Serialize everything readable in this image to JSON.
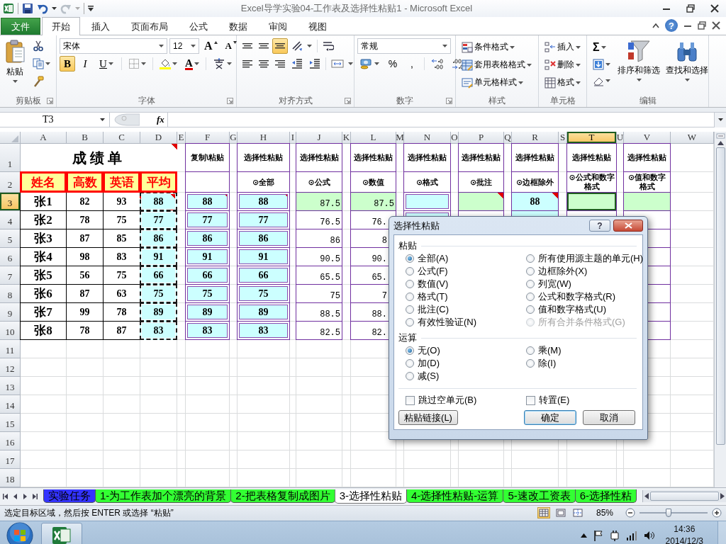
{
  "window": {
    "title": "Excel导学实验04-工作表及选择性粘贴1 - Microsoft Excel"
  },
  "ribbon": {
    "file_tab": "文件",
    "help": "?",
    "tabs": [
      {
        "label": "开始",
        "selected": true
      },
      {
        "label": "插入",
        "selected": false
      },
      {
        "label": "页面布局",
        "selected": false
      },
      {
        "label": "公式",
        "selected": false
      },
      {
        "label": "数据",
        "selected": false
      },
      {
        "label": "审阅",
        "selected": false
      },
      {
        "label": "视图",
        "selected": false
      }
    ],
    "groups": [
      {
        "kind": "clipboard",
        "label": "剪贴板",
        "paste": "粘贴"
      },
      {
        "kind": "font",
        "label": "字体",
        "font_name": "宋体",
        "font_size": "12",
        "grow": "A",
        "shrink": "A",
        "font_color": "A",
        "styles": [
          {
            "label": "B",
            "selected": true
          },
          {
            "label": "I",
            "selected": false
          },
          {
            "label": "U",
            "selected": false
          }
        ]
      },
      {
        "kind": "alignment",
        "label": "对齐方式",
        "vertical": [
          {
            "selected": false
          },
          {
            "selected": false
          },
          {
            "selected": true
          }
        ]
      },
      {
        "kind": "number",
        "label": "数字",
        "format": "常规",
        "symbols": [
          "%",
          ","
        ]
      },
      {
        "kind": "styles",
        "label": "样式",
        "items": [
          "条件格式",
          "套用表格格式",
          "单元格样式"
        ]
      },
      {
        "kind": "cells",
        "label": "单元格",
        "items": [
          "插入",
          "删除",
          "格式"
        ]
      },
      {
        "kind": "editing",
        "label": "编辑",
        "sum": "Σ",
        "items": [
          "排序和筛选",
          "查找和选择"
        ]
      }
    ]
  },
  "formula_bar": {
    "name_box": "T3",
    "fx": "fx"
  },
  "sheet": {
    "columns": [
      {
        "label": "A",
        "selected": false
      },
      {
        "label": "B",
        "selected": false
      },
      {
        "label": "C",
        "selected": false
      },
      {
        "label": "D",
        "selected": false
      },
      {
        "label": "E",
        "selected": false
      },
      {
        "label": "F",
        "selected": false
      },
      {
        "label": "G",
        "selected": false
      },
      {
        "label": "H",
        "selected": false
      },
      {
        "label": "I",
        "selected": false
      },
      {
        "label": "J",
        "selected": false
      },
      {
        "label": "K",
        "selected": false
      },
      {
        "label": "L",
        "selected": false
      },
      {
        "label": "M",
        "selected": false
      },
      {
        "label": "N",
        "selected": false
      },
      {
        "label": "O",
        "selected": false
      },
      {
        "label": "P",
        "selected": false
      },
      {
        "label": "Q",
        "selected": false
      },
      {
        "label": "R",
        "selected": false
      },
      {
        "label": "S",
        "selected": false
      },
      {
        "label": "T",
        "selected": true
      },
      {
        "label": "U",
        "selected": false
      },
      {
        "label": "V",
        "selected": false
      },
      {
        "label": "W",
        "selected": false
      }
    ],
    "rows": [
      {
        "label": "1",
        "selected": false
      },
      {
        "label": "2",
        "selected": false
      },
      {
        "label": "3",
        "selected": true
      },
      {
        "label": "4",
        "selected": false
      },
      {
        "label": "5",
        "selected": false
      },
      {
        "label": "6",
        "selected": false
      },
      {
        "label": "7",
        "selected": false
      },
      {
        "label": "8",
        "selected": false
      },
      {
        "label": "9",
        "selected": false
      },
      {
        "label": "10",
        "selected": false
      },
      {
        "label": "11",
        "selected": false
      },
      {
        "label": "12",
        "selected": false
      },
      {
        "label": "13",
        "selected": false
      },
      {
        "label": "14",
        "selected": false
      },
      {
        "label": "15",
        "selected": false
      },
      {
        "label": "16",
        "selected": false
      },
      {
        "label": "17",
        "selected": false
      },
      {
        "label": "18",
        "selected": false
      }
    ],
    "score_table": {
      "title": {
        "text": "成绩单",
        "comment": true
      },
      "headers": [
        "姓名",
        "高数",
        "英语",
        "平均"
      ],
      "rows": [
        {
          "cells": [
            {
              "text": "张1"
            },
            {
              "text": "82"
            },
            {
              "text": "93"
            },
            {
              "text": "88",
              "color": "#ccffff",
              "marquee": true,
              "comment": true
            }
          ]
        },
        {
          "cells": [
            {
              "text": "张2"
            },
            {
              "text": "78"
            },
            {
              "text": "75"
            },
            {
              "text": "77",
              "color": "#ccffff",
              "marquee": true
            }
          ]
        },
        {
          "cells": [
            {
              "text": "张3"
            },
            {
              "text": "87"
            },
            {
              "text": "85"
            },
            {
              "text": "86",
              "color": "#ccffff",
              "marquee": true
            }
          ]
        },
        {
          "cells": [
            {
              "text": "张4"
            },
            {
              "text": "98"
            },
            {
              "text": "83"
            },
            {
              "text": "91",
              "color": "#ccffff",
              "marquee": true
            }
          ]
        },
        {
          "cells": [
            {
              "text": "张5"
            },
            {
              "text": "56"
            },
            {
              "text": "75"
            },
            {
              "text": "66",
              "color": "#ccffff",
              "marquee": true
            }
          ]
        },
        {
          "cells": [
            {
              "text": "张6"
            },
            {
              "text": "87"
            },
            {
              "text": "63"
            },
            {
              "text": "75",
              "color": "#ccffff",
              "marquee": true
            }
          ]
        },
        {
          "cells": [
            {
              "text": "张7"
            },
            {
              "text": "99"
            },
            {
              "text": "78"
            },
            {
              "text": "89",
              "color": "#ccffff",
              "marquee": true
            }
          ]
        },
        {
          "cells": [
            {
              "text": "张8"
            },
            {
              "text": "78"
            },
            {
              "text": "87"
            },
            {
              "text": "83",
              "color": "#ccffff",
              "marquee": true
            }
          ]
        }
      ]
    },
    "paste_blocks": [
      {
        "title": "复制\\粘贴",
        "cells": [
          {
            "text": "88",
            "kind": "boxed",
            "color": "#ccffff",
            "comment": true
          },
          {
            "text": "77",
            "kind": "boxed",
            "color": "#ccffff"
          },
          {
            "text": "86",
            "kind": "boxed",
            "color": "#ccffff"
          },
          {
            "text": "91",
            "kind": "boxed",
            "color": "#ccffff"
          },
          {
            "text": "66",
            "kind": "boxed",
            "color": "#ccffff"
          },
          {
            "text": "75",
            "kind": "boxed",
            "color": "#ccffff"
          },
          {
            "text": "89",
            "kind": "boxed",
            "color": "#ccffff"
          },
          {
            "text": "83",
            "kind": "boxed",
            "color": "#ccffff"
          }
        ]
      },
      {
        "title": "选择性粘贴",
        "option": "⊙全部",
        "cells": [
          {
            "text": "88",
            "kind": "boxed",
            "color": "#ccffff",
            "comment": true
          },
          {
            "text": "77",
            "kind": "boxed",
            "color": "#ccffff"
          },
          {
            "text": "86",
            "kind": "boxed",
            "color": "#ccffff"
          },
          {
            "text": "91",
            "kind": "boxed",
            "color": "#ccffff"
          },
          {
            "text": "66",
            "kind": "boxed",
            "color": "#ccffff"
          },
          {
            "text": "75",
            "kind": "boxed",
            "color": "#ccffff"
          },
          {
            "text": "89",
            "kind": "boxed",
            "color": "#ccffff"
          },
          {
            "text": "83",
            "kind": "boxed",
            "color": "#ccffff"
          }
        ]
      },
      {
        "title": "选择性粘贴",
        "option": "⊙公式",
        "cells": [
          {
            "text": "87.5",
            "kind": "number",
            "color": "#ccffcc"
          },
          {
            "text": "76.5",
            "kind": "number"
          },
          {
            "text": "86",
            "kind": "number"
          },
          {
            "text": "90.5",
            "kind": "number"
          },
          {
            "text": "65.5",
            "kind": "number"
          },
          {
            "text": "75",
            "kind": "number"
          },
          {
            "text": "88.5",
            "kind": "number"
          },
          {
            "text": "82.5",
            "kind": "number"
          }
        ]
      },
      {
        "title": "选择性粘贴",
        "option": "⊙数值",
        "cells": [
          {
            "text": "87.5",
            "kind": "number",
            "color": "#ccffcc"
          },
          {
            "text": "76.",
            "kind": "cut-number"
          },
          {
            "text": "8",
            "kind": "cut-number"
          },
          {
            "text": "90.",
            "kind": "cut-number"
          },
          {
            "text": "65.",
            "kind": "cut-number"
          },
          {
            "text": "7",
            "kind": "cut-number"
          },
          {
            "text": "88.",
            "kind": "cut-number"
          },
          {
            "text": "82.",
            "kind": "cut-number"
          }
        ]
      },
      {
        "title": "选择性粘贴",
        "option": "⊙格式",
        "cells": [
          {
            "kind": "boxed",
            "color": "#ccffff"
          },
          {
            "kind": "boxed",
            "color": "#ccffff"
          }
        ]
      },
      {
        "title": "选择性粘贴",
        "option": "⊙批注",
        "cells": [
          {
            "kind": "plain",
            "color": "#ccffcc",
            "comment": true
          },
          {
            "kind": "plain"
          }
        ]
      },
      {
        "title": "选择性粘贴",
        "option": "⊙边框除外",
        "cells": [
          {
            "text": "88",
            "kind": "plain",
            "color": "#ccffff",
            "comment": true
          },
          {
            "kind": "plain",
            "color": "#ccffff"
          }
        ]
      },
      {
        "title": "选择性粘贴",
        "option": "⊙公式和数字格式",
        "cells": [
          {
            "kind": "plain",
            "color": "#ccffcc",
            "selected": true
          },
          {
            "kind": "plain"
          }
        ]
      },
      {
        "title": "选择性粘贴",
        "option": "⊙值和数字格式",
        "cells": [
          {
            "kind": "plain",
            "color": "#ccffcc"
          },
          {
            "kind": "plain"
          },
          {
            "kind": "plain"
          },
          {
            "kind": "plain"
          },
          {
            "kind": "plain"
          },
          {
            "kind": "plain"
          },
          {
            "kind": "plain"
          },
          {
            "kind": "plain"
          }
        ]
      }
    ]
  },
  "dialog": {
    "title": "选择性粘贴",
    "help": "?",
    "paste_section": "粘贴",
    "paste_options": [
      {
        "label": "全部(A)",
        "selected": true,
        "disabled": false
      },
      {
        "label": "所有使用源主题的单元(H)",
        "selected": false,
        "disabled": false
      },
      {
        "label": "公式(F)",
        "selected": false,
        "disabled": false
      },
      {
        "label": "边框除外(X)",
        "selected": false,
        "disabled": false
      },
      {
        "label": "数值(V)",
        "selected": false,
        "disabled": false
      },
      {
        "label": "列宽(W)",
        "selected": false,
        "disabled": false
      },
      {
        "label": "格式(T)",
        "selected": false,
        "disabled": false
      },
      {
        "label": "公式和数字格式(R)",
        "selected": false,
        "disabled": false
      },
      {
        "label": "批注(C)",
        "selected": false,
        "disabled": false
      },
      {
        "label": "值和数字格式(U)",
        "selected": false,
        "disabled": false
      },
      {
        "label": "有效性验证(N)",
        "selected": false,
        "disabled": false
      },
      {
        "label": "所有合并条件格式(G)",
        "selected": false,
        "disabled": true
      }
    ],
    "operation_section": "运算",
    "operations": [
      {
        "label": "无(O)",
        "selected": true
      },
      {
        "label": "乘(M)",
        "selected": false
      },
      {
        "label": "加(D)",
        "selected": false
      },
      {
        "label": "除(I)",
        "selected": false
      },
      {
        "label": "减(S)",
        "selected": false
      }
    ],
    "checkboxes": [
      {
        "label": "跳过空单元(B)",
        "checked": false
      },
      {
        "label": "转置(E)",
        "checked": false
      }
    ],
    "buttons": [
      {
        "label": "粘贴链接(L)",
        "default": false
      },
      {
        "label": "确定",
        "default": true
      },
      {
        "label": "取消",
        "default": false
      }
    ]
  },
  "sheet_tabs": [
    {
      "label": "实验任务",
      "selected": false,
      "color": "#3333ff"
    },
    {
      "label": "1-为工作表加个漂亮的背景",
      "selected": false,
      "color": "#33ff33"
    },
    {
      "label": "2-把表格复制成图片",
      "selected": false,
      "color": "#33ff33"
    },
    {
      "label": "3-选择性粘贴",
      "selected": true
    },
    {
      "label": "4-选择性粘贴-运算",
      "selected": false,
      "color": "#33ff33"
    },
    {
      "label": "5-速改工资表",
      "selected": false,
      "color": "#33ff33"
    },
    {
      "label": "6-选择性粘",
      "selected": false,
      "color": "#33ff33"
    }
  ],
  "status_bar": {
    "message": "选定目标区域，然后按 ENTER 或选择 “粘贴”",
    "views": [
      {
        "selected": true
      },
      {
        "selected": false
      },
      {
        "selected": false
      }
    ],
    "zoom": "85%",
    "zoom_slider": {
      "level": 0.43
    }
  },
  "taskbar": {
    "time": "14:36",
    "date": "2014/12/3"
  }
}
